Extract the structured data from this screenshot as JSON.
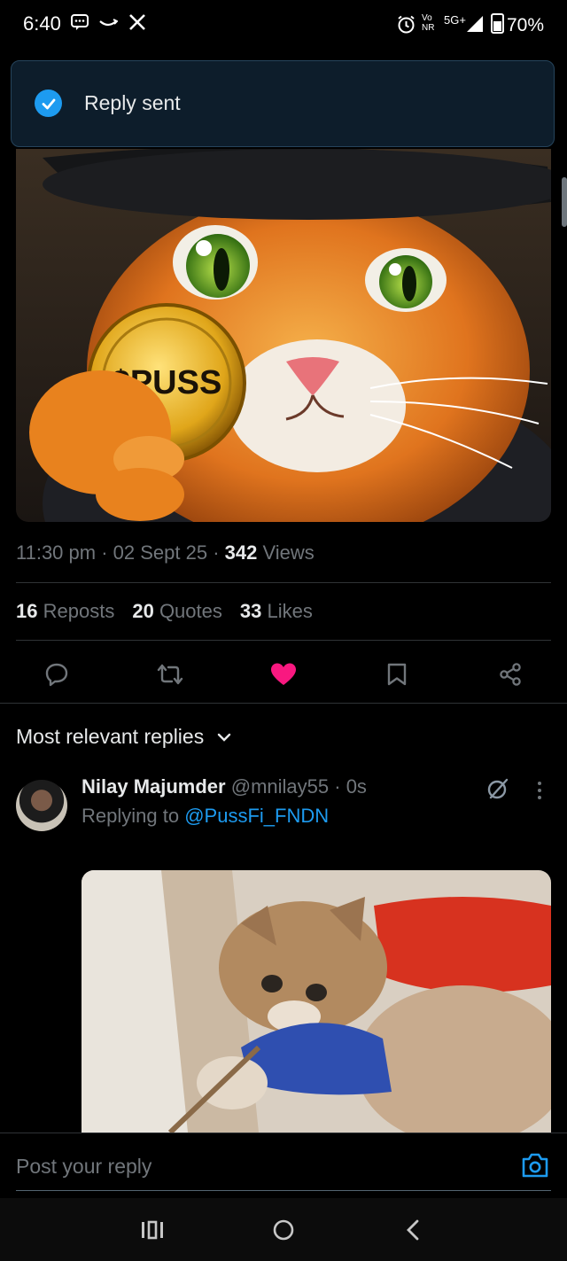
{
  "status_bar": {
    "time": "6:40",
    "network": "5G+",
    "volte": "Vo NR",
    "battery": "70%"
  },
  "toast": {
    "text": "Reply sent"
  },
  "post": {
    "image_caption": "$PUSS",
    "time": "11:30 pm",
    "date": "02 Sept 25",
    "views_count": "342",
    "views_label": "Views",
    "reposts_count": "16",
    "reposts_label": "Reposts",
    "quotes_count": "20",
    "quotes_label": "Quotes",
    "likes_count": "33",
    "likes_label": "Likes"
  },
  "actions": {
    "reply_icon": "reply-icon",
    "repost_icon": "repost-icon",
    "like_icon": "heart-icon",
    "bookmark_icon": "bookmark-icon",
    "share_icon": "share-icon",
    "like_color": "#f91880"
  },
  "replies": {
    "sort_label": "Most relevant replies",
    "items": [
      {
        "name": "Nilay Majumder",
        "handle": "@mnilay55",
        "time": "0s",
        "replying_prefix": "Replying to",
        "replying_to": "@PussFi_FNDN"
      }
    ]
  },
  "composer": {
    "placeholder": "Post your reply"
  },
  "colors": {
    "accent": "#1d9bf0",
    "background": "#000000",
    "muted": "#71767b"
  }
}
